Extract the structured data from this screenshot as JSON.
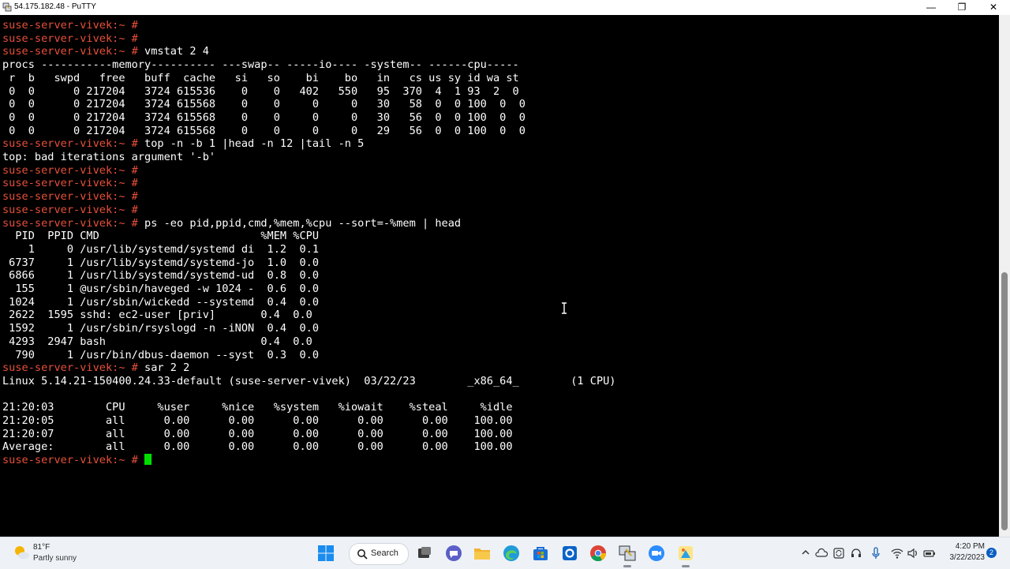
{
  "window": {
    "title": "54.175.182.48 - PuTTY",
    "controls": {
      "minimize": "—",
      "restore": "❐",
      "close": "✕"
    }
  },
  "terminal": {
    "prompt": "suse-server-vivek:~ #",
    "lines": [
      {
        "prompt": true,
        "cmd": ""
      },
      {
        "prompt": true,
        "cmd": ""
      },
      {
        "prompt": true,
        "cmd": " vmstat 2 4"
      },
      {
        "text": "procs -----------memory---------- ---swap-- -----io---- -system-- ------cpu-----"
      },
      {
        "text": " r  b   swpd   free   buff  cache   si   so    bi    bo   in   cs us sy id wa st"
      },
      {
        "text": " 0  0      0 217204   3724 615536    0    0   402   550   95  370  4  1 93  2  0"
      },
      {
        "text": " 0  0      0 217204   3724 615568    0    0     0     0   30   58  0  0 100  0  0"
      },
      {
        "text": " 0  0      0 217204   3724 615568    0    0     0     0   30   56  0  0 100  0  0"
      },
      {
        "text": " 0  0      0 217204   3724 615568    0    0     0     0   29   56  0  0 100  0  0"
      },
      {
        "prompt": true,
        "cmd": " top -n -b 1 |head -n 12 |tail -n 5"
      },
      {
        "text": "top: bad iterations argument '-b'"
      },
      {
        "prompt": true,
        "cmd": ""
      },
      {
        "prompt": true,
        "cmd": ""
      },
      {
        "prompt": true,
        "cmd": ""
      },
      {
        "prompt": true,
        "cmd": ""
      },
      {
        "prompt": true,
        "cmd": " ps -eo pid,ppid,cmd,%mem,%cpu --sort=-%mem | head"
      },
      {
        "text": "  PID  PPID CMD                         %MEM %CPU"
      },
      {
        "text": "    1     0 /usr/lib/systemd/systemd di  1.2  0.1"
      },
      {
        "text": " 6737     1 /usr/lib/systemd/systemd-jo  1.0  0.0"
      },
      {
        "text": " 6866     1 /usr/lib/systemd/systemd-ud  0.8  0.0"
      },
      {
        "text": "  155     1 @usr/sbin/haveged -w 1024 -  0.6  0.0"
      },
      {
        "text": " 1024     1 /usr/sbin/wickedd --systemd  0.4  0.0"
      },
      {
        "text": " 2622  1595 sshd: ec2-user [priv]       0.4  0.0"
      },
      {
        "text": " 1592     1 /usr/sbin/rsyslogd -n -iNON  0.4  0.0"
      },
      {
        "text": " 4293  2947 bash                        0.4  0.0"
      },
      {
        "text": "  790     1 /usr/bin/dbus-daemon --syst  0.3  0.0"
      },
      {
        "prompt": true,
        "cmd": " sar 2 2"
      },
      {
        "text": "Linux 5.14.21-150400.24.33-default (suse-server-vivek)  03/22/23        _x86_64_        (1 CPU)"
      },
      {
        "text": ""
      },
      {
        "text": "21:20:03        CPU     %user     %nice   %system   %iowait    %steal     %idle"
      },
      {
        "text": "21:20:05        all      0.00      0.00      0.00      0.00      0.00    100.00"
      },
      {
        "text": "21:20:07        all      0.00      0.00      0.00      0.00      0.00    100.00"
      },
      {
        "text": "Average:        all      0.00      0.00      0.00      0.00      0.00    100.00"
      },
      {
        "prompt": true,
        "cmd": " ",
        "cursor": true
      }
    ]
  },
  "taskbar": {
    "weather": {
      "temp": "81°F",
      "desc": "Partly sunny"
    },
    "search_label": "Search",
    "clock": {
      "time": "4:20 PM",
      "date": "3/22/2023"
    },
    "notification_count": "2"
  },
  "colors": {
    "prompt": "#e8503a",
    "cursor": "#00e000",
    "terminal_bg": "#000000",
    "terminal_fg": "#ffffff"
  }
}
